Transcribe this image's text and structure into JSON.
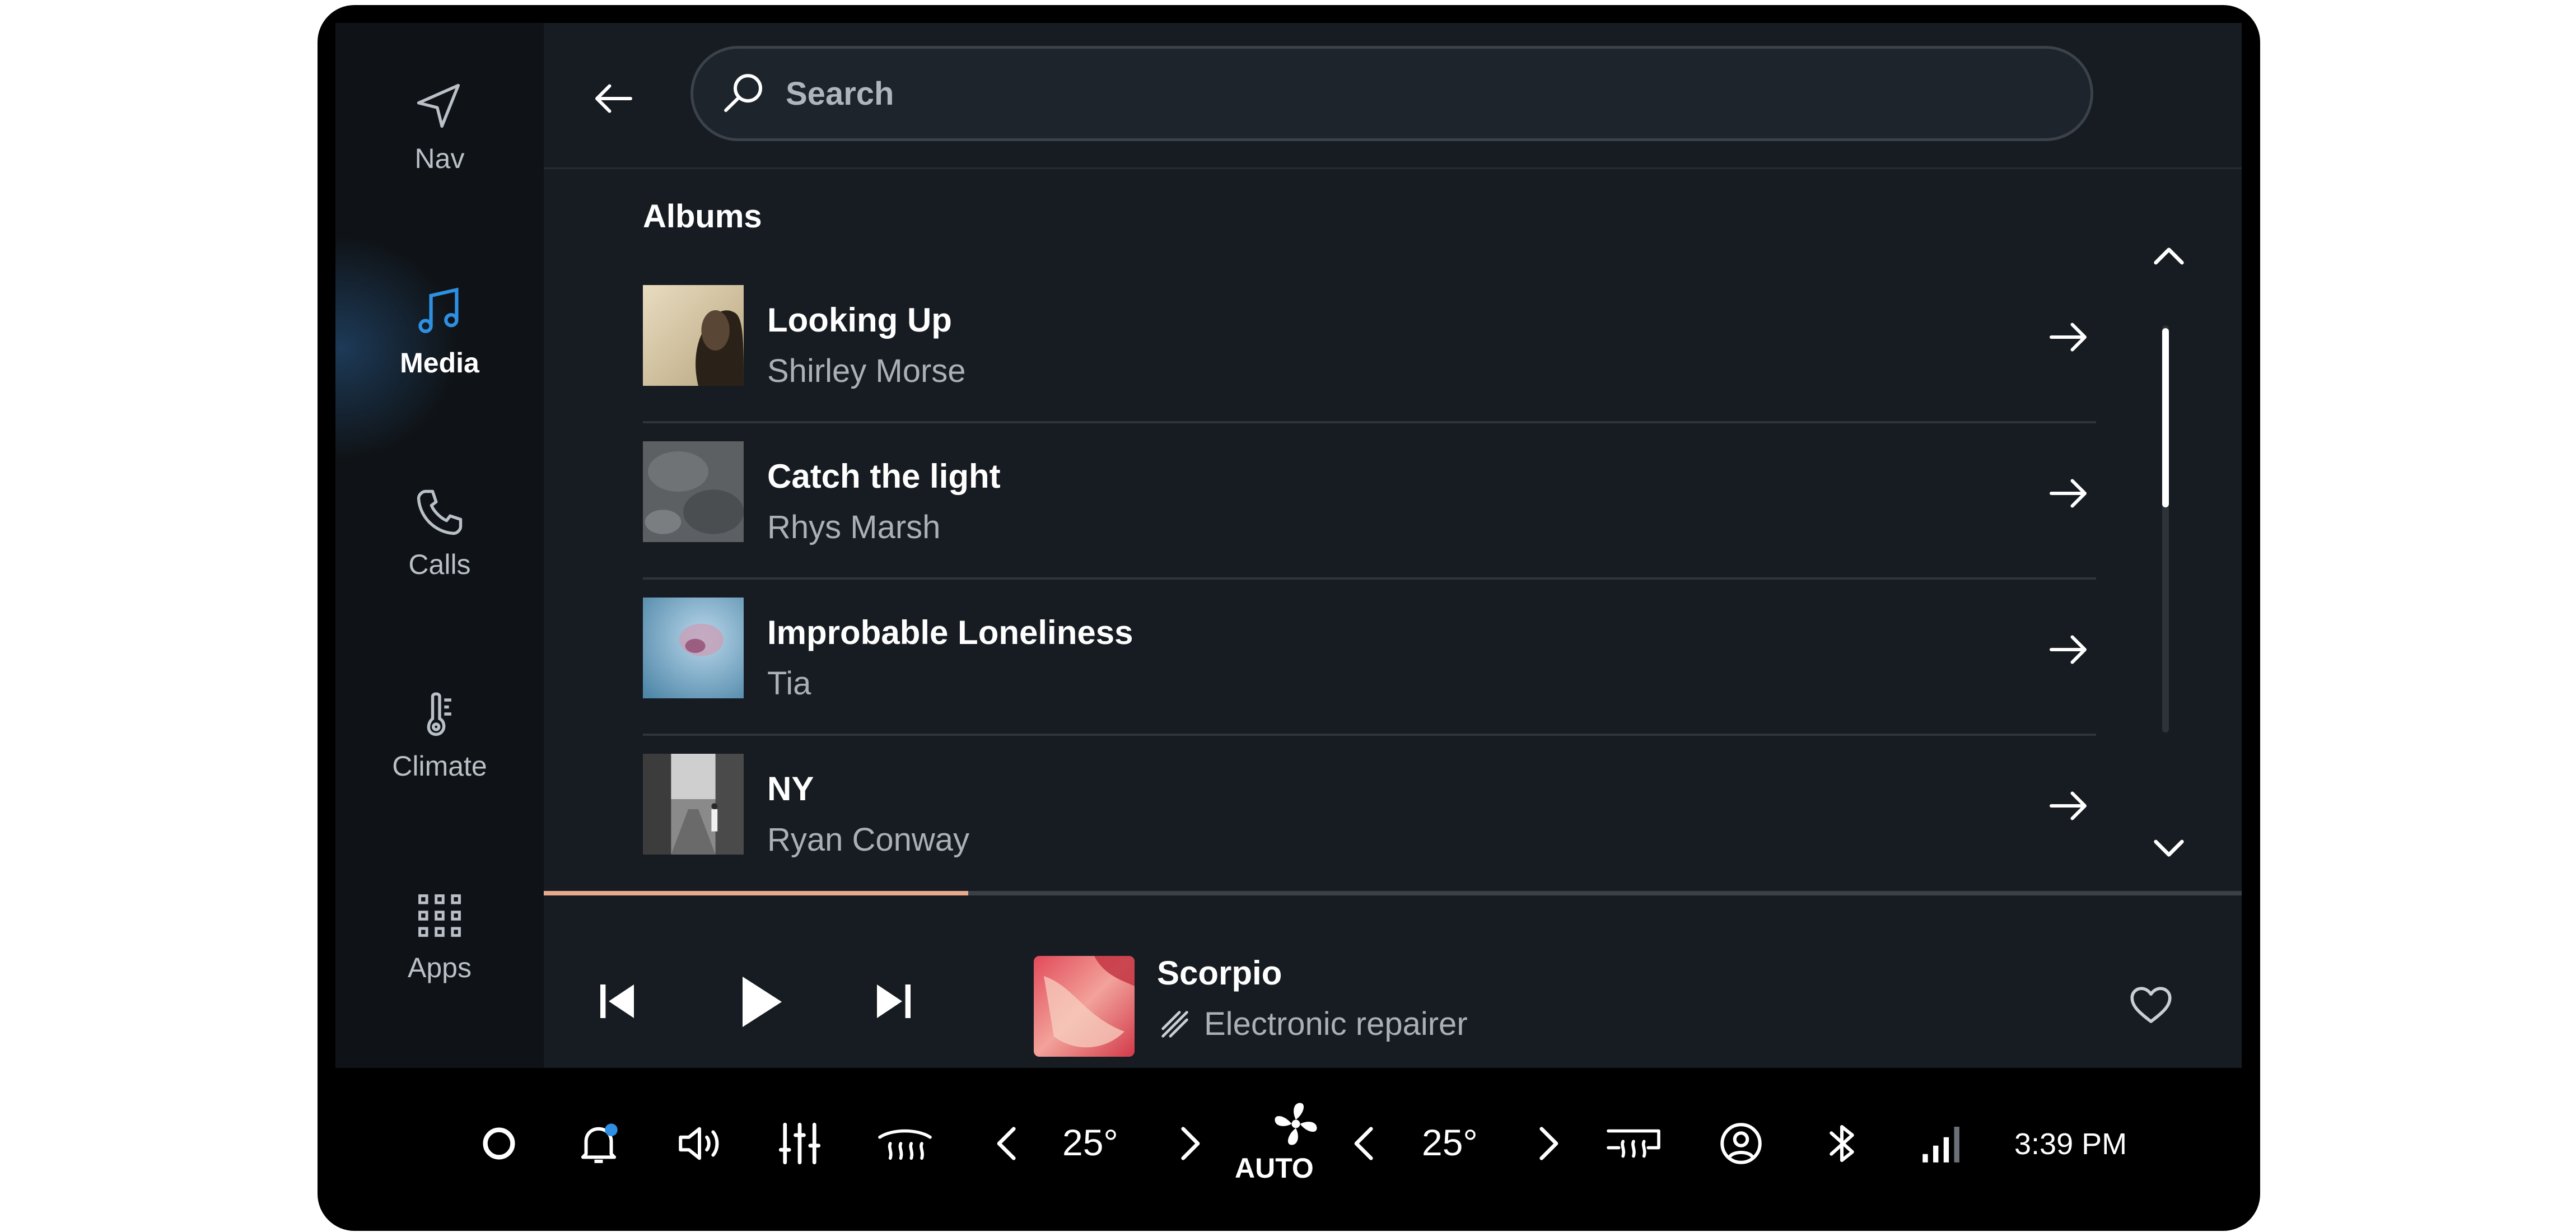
{
  "rail": {
    "items": [
      {
        "label": "Nav",
        "icon": "navigation-arrow-icon",
        "active": false
      },
      {
        "label": "Media",
        "icon": "music-note-icon",
        "active": true
      },
      {
        "label": "Calls",
        "icon": "phone-icon",
        "active": false
      },
      {
        "label": "Climate",
        "icon": "thermometer-icon",
        "active": false
      },
      {
        "label": "Apps",
        "icon": "apps-grid-icon",
        "active": false
      }
    ]
  },
  "search": {
    "placeholder": "Search"
  },
  "albums": {
    "section_title": "Albums",
    "items": [
      {
        "title": "Looking Up",
        "artist": "Shirley Morse"
      },
      {
        "title": "Catch the light",
        "artist": "Rhys Marsh"
      },
      {
        "title": "Improbable Loneliness",
        "artist": "Tia"
      },
      {
        "title": "NY",
        "artist": "Ryan Conway"
      }
    ]
  },
  "player": {
    "title": "Scorpio",
    "artist": "Electronic repairer",
    "progress_fraction": 0.25
  },
  "system": {
    "temp_left": "25°",
    "temp_right": "25°",
    "fan_mode": "AUTO",
    "time": "3:39 PM"
  },
  "colors": {
    "accent": "#2f8fe0",
    "progress": "#e8a98c",
    "background": "#171c22",
    "rail": "#0f1317",
    "notification_dot": "#2f8fe0"
  }
}
